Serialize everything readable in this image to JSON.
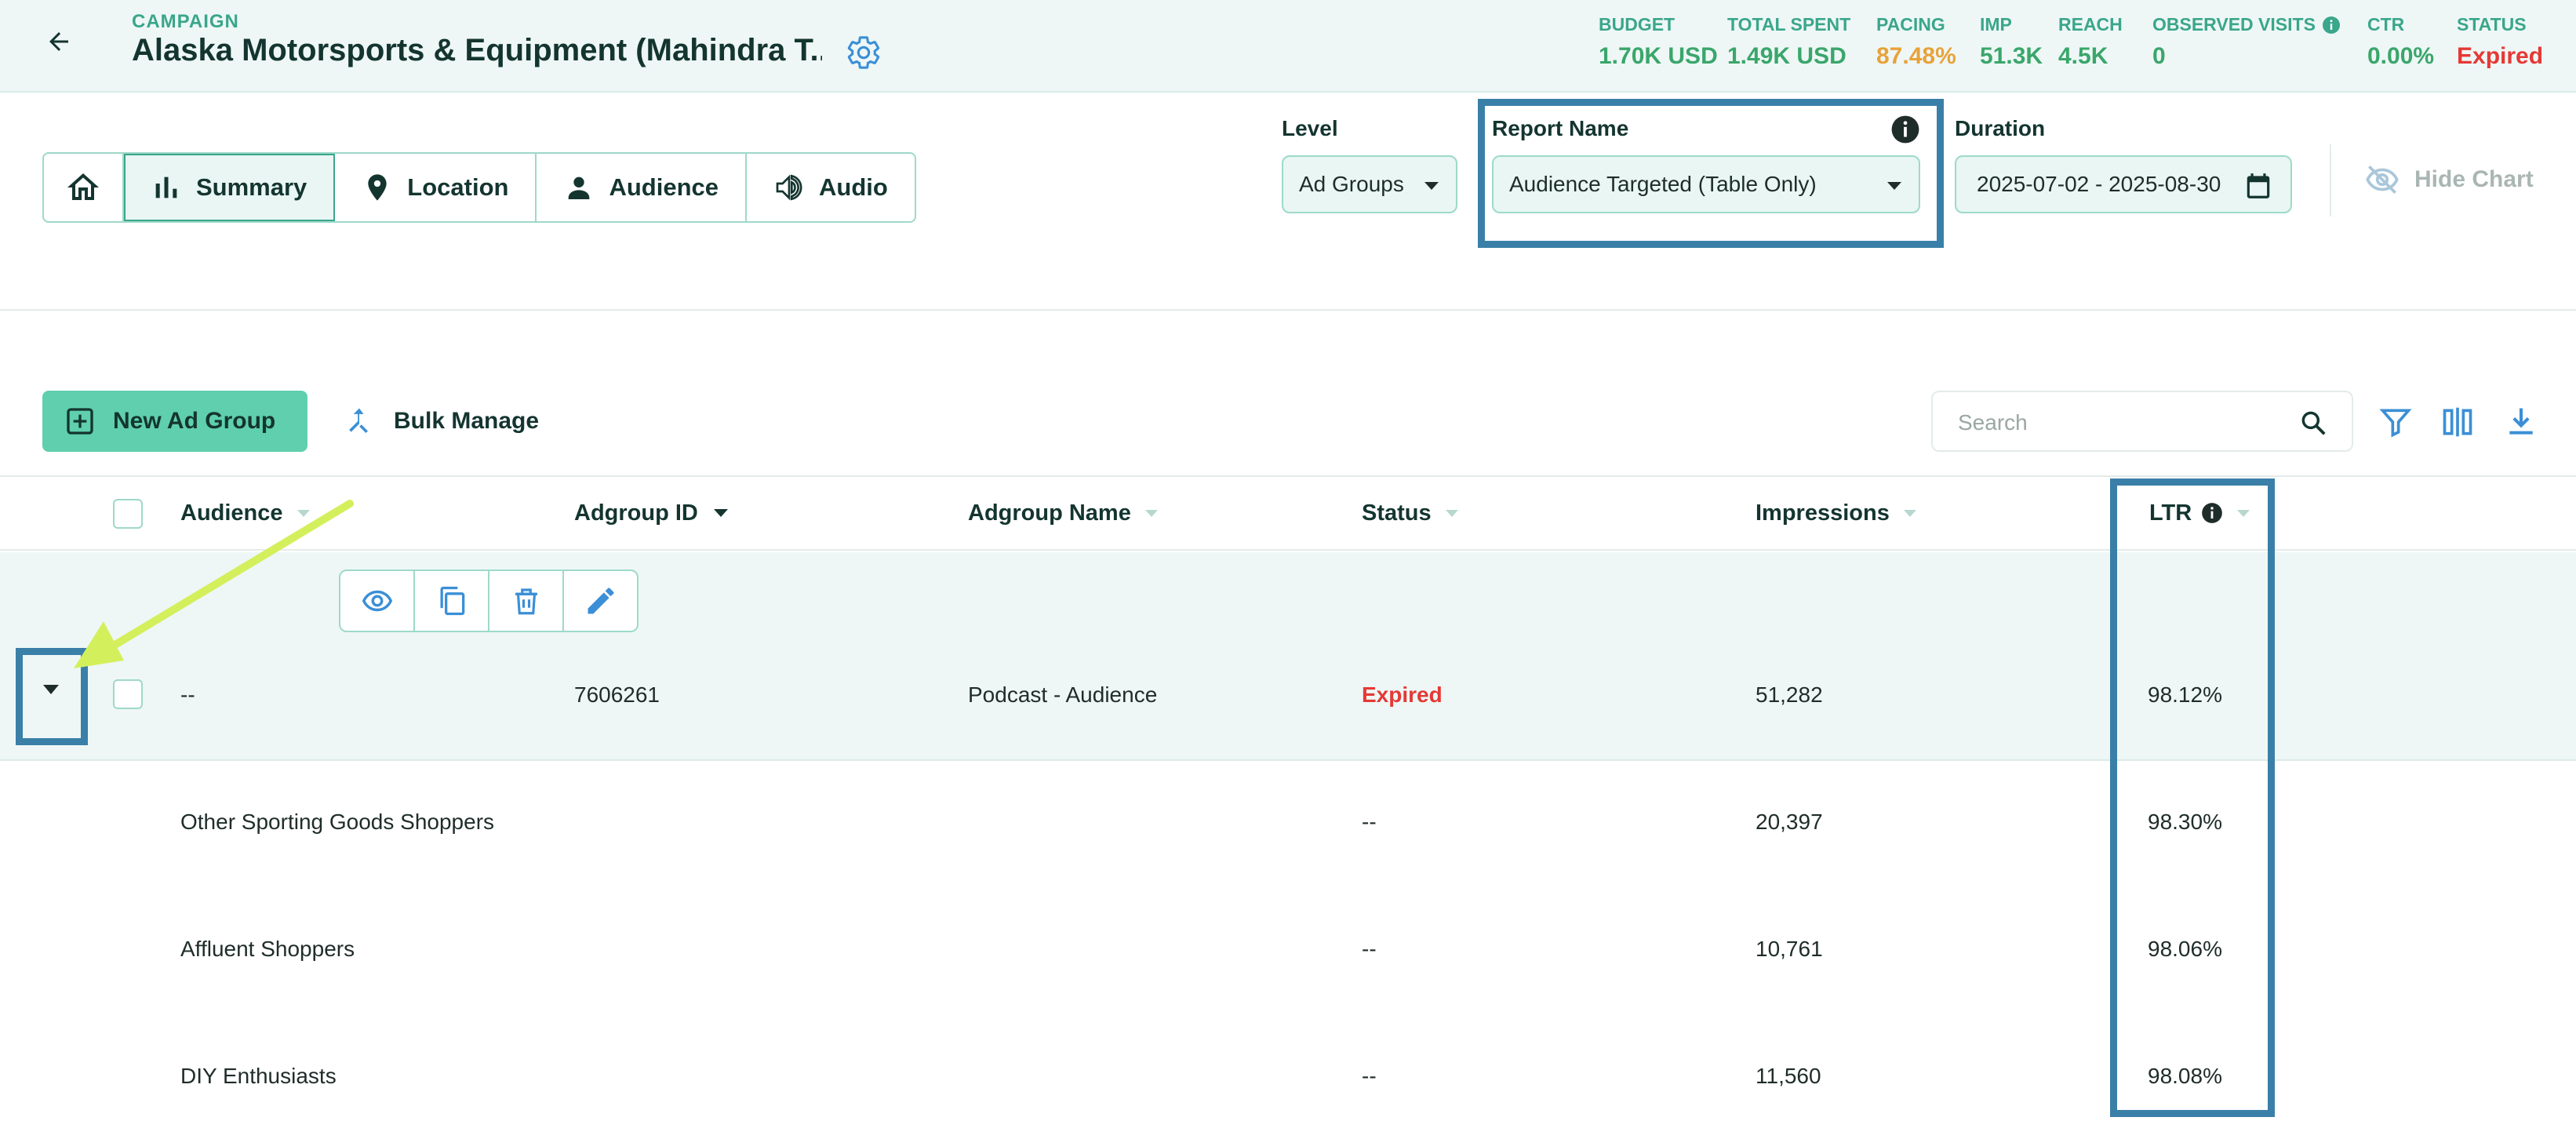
{
  "header": {
    "campaign_label": "CAMPAIGN",
    "campaign_title": "Alaska Motorsports & Equipment (Mahindra T...",
    "stats": [
      {
        "label": "BUDGET",
        "value": "1.70K USD",
        "color": "#3aa66b"
      },
      {
        "label": "TOTAL SPENT",
        "value": "1.49K USD",
        "color": "#3aa66b"
      },
      {
        "label": "PACING",
        "value": "87.48%",
        "color": "#e8a23a"
      },
      {
        "label": "IMP",
        "value": "51.3K",
        "color": "#3aa66b"
      },
      {
        "label": "REACH",
        "value": "4.5K",
        "color": "#3aa66b"
      },
      {
        "label": "OBSERVED VISITS",
        "value": "0",
        "color": "#3aa66b",
        "has_info_icon": true
      },
      {
        "label": "CTR",
        "value": "0.00%",
        "color": "#3aa66b"
      },
      {
        "label": "STATUS",
        "value": "Expired",
        "color": "#e53935"
      }
    ]
  },
  "tabs": [
    {
      "label": "",
      "icon": "home-icon"
    },
    {
      "label": "Summary",
      "icon": "bar-chart-icon",
      "active": true
    },
    {
      "label": "Location",
      "icon": "location-pin-icon"
    },
    {
      "label": "Audience",
      "icon": "person-icon"
    },
    {
      "label": "Audio",
      "icon": "speaker-icon"
    }
  ],
  "controls": {
    "level_label": "Level",
    "level_value": "Ad Groups",
    "report_label": "Report Name",
    "report_value": "Audience Targeted (Table Only)",
    "duration_label": "Duration",
    "duration_value": "2025-07-02 - 2025-08-30",
    "hide_chart": "Hide Chart"
  },
  "actions": {
    "new_adgroup": "New Ad Group",
    "bulk_manage": "Bulk Manage",
    "search_placeholder": "Search"
  },
  "table": {
    "columns": [
      "Audience",
      "Adgroup ID",
      "Adgroup Name",
      "Status",
      "Impressions",
      "LTR"
    ],
    "main_row": {
      "audience": "--",
      "adgroup_id": "7606261",
      "adgroup_name": "Podcast - Audience",
      "status": "Expired",
      "impressions": "51,282",
      "ltr": "98.12%"
    },
    "sub_rows": [
      {
        "audience": "Other Sporting Goods Shoppers",
        "status": "--",
        "impressions": "20,397",
        "ltr": "98.30%"
      },
      {
        "audience": "Affluent Shoppers",
        "status": "--",
        "impressions": "10,761",
        "ltr": "98.06%"
      },
      {
        "audience": "DIY Enthusiasts",
        "status": "--",
        "impressions": "11,560",
        "ltr": "98.08%"
      }
    ]
  },
  "colors": {
    "accent": "#3aa68b",
    "primary_button": "#5fcfae",
    "highlight_box": "#3a7fa8",
    "annotation_arrow": "#d4ef5c",
    "expired": "#e53935",
    "icon_blue": "#3b8fd6"
  }
}
